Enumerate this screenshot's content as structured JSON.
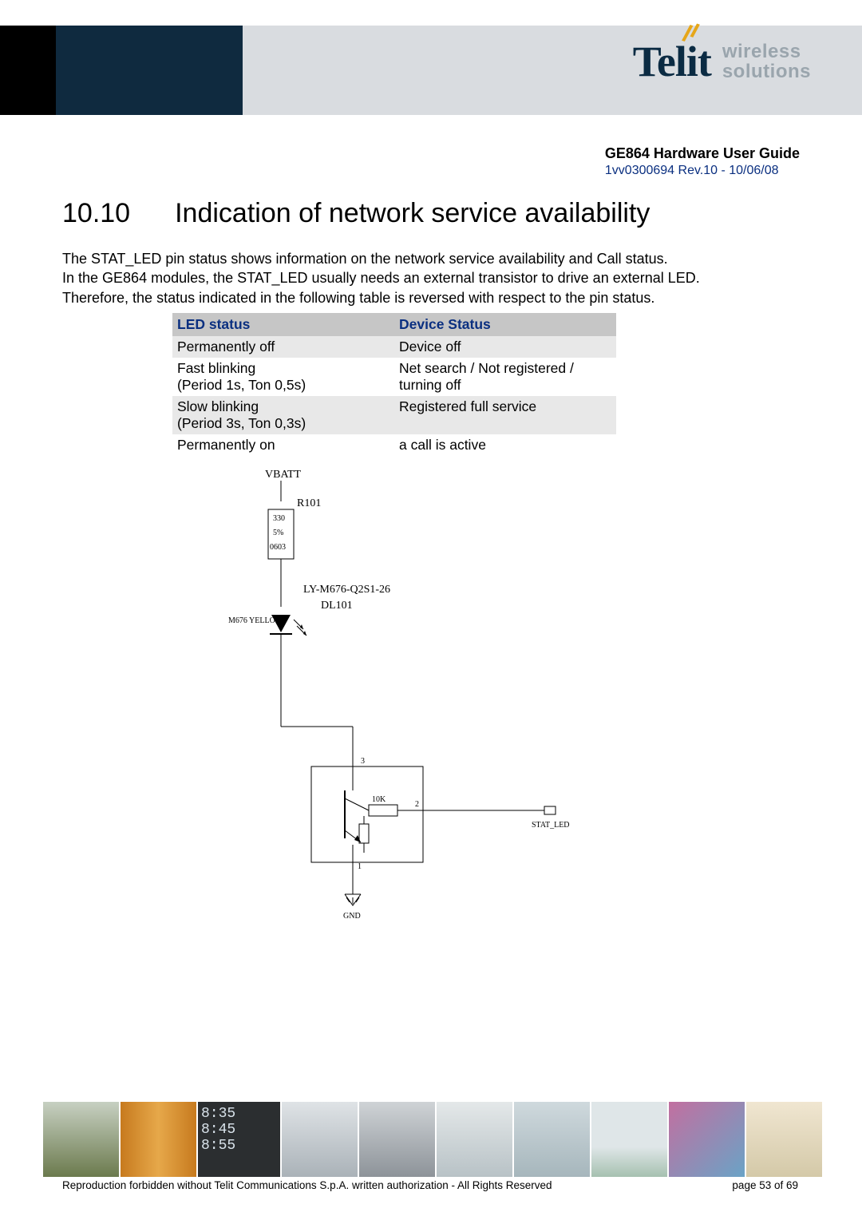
{
  "brand": {
    "name": "Telit",
    "tagline_line1": "wireless",
    "tagline_line2": "solutions"
  },
  "doc": {
    "title": "GE864 Hardware User Guide",
    "revision": "1vv0300694 Rev.10 - 10/06/08"
  },
  "section": {
    "number": "10.10",
    "title": "Indication of network service availability"
  },
  "paragraph": {
    "l1": "The STAT_LED pin status shows information on the network service availability and Call status.",
    "l2": "In the GE864 modules, the STAT_LED usually needs an external transistor to drive an external LED.",
    "l3": "Therefore, the status indicated in the following table is reversed with respect to the pin status."
  },
  "table": {
    "headers": {
      "c1": "LED status",
      "c2": "Device Status"
    },
    "rows": [
      {
        "c1": "Permanently off",
        "c2": "Device off"
      },
      {
        "c1": "Fast blinking\n(Period 1s, Ton 0,5s)",
        "c2": "Net search / Not registered / turning off"
      },
      {
        "c1": "Slow blinking\n(Period 3s, Ton 0,3s)",
        "c2": "Registered full service"
      },
      {
        "c1": "Permanently on",
        "c2": "a call is active"
      }
    ]
  },
  "schematic": {
    "vbatt": "VBATT",
    "r_name": "R101",
    "r_value": "330",
    "r_tol": "5%",
    "r_pkg": "0603",
    "led_part": "LY-M676-Q2S1-26",
    "led_ref": "DL101",
    "led_color": "M676\nYELLOW",
    "r_base": "10K",
    "pin3": "3",
    "pin2": "2",
    "pin1": "1",
    "signal": "STAT_LED",
    "gnd": "GND"
  },
  "footer": {
    "copyright": "Reproduction forbidden without Telit Communications S.p.A. written authorization - All Rights Reserved",
    "page": "page 53 of 69"
  },
  "tiles": {
    "clock1": "8:35",
    "clock2": "8:45",
    "clock3": "8:55"
  }
}
